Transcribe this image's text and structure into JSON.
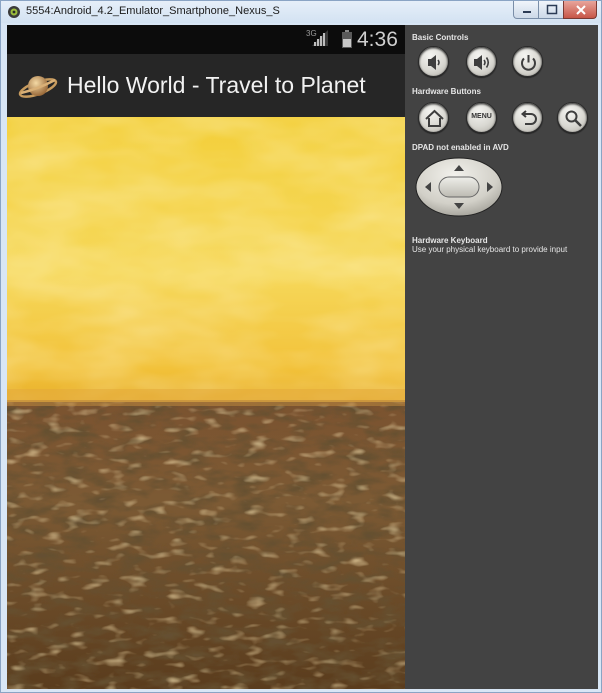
{
  "window": {
    "title": "5554:Android_4.2_Emulator_Smartphone_Nexus_S"
  },
  "status_bar": {
    "network": "3G",
    "time": "4:36"
  },
  "app": {
    "title": "Hello World - Travel to Planet"
  },
  "controls": {
    "basic_label": "Basic Controls",
    "hardware_label": "Hardware Buttons",
    "menu_label": "MENU",
    "dpad_label": "DPAD not enabled in AVD",
    "keyboard_label": "Hardware Keyboard",
    "keyboard_hint": "Use your physical keyboard to provide input"
  },
  "icons": {
    "window": "android-emulator-icon",
    "app": "planet-saturn-icon",
    "volume_down": "volume-down-icon",
    "volume_up": "volume-up-icon",
    "power": "power-icon",
    "home": "home-icon",
    "back": "back-icon",
    "search": "search-icon"
  },
  "colors": {
    "sky_top": "#f3cf3a",
    "ground": "#6e4a26",
    "panel": "#434343",
    "actionbar": "#262626"
  }
}
